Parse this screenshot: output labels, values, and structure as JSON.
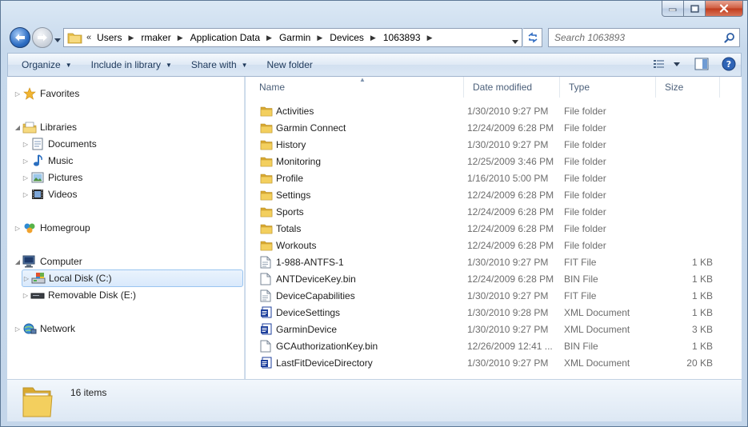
{
  "window": {
    "buttons": {
      "minimize": "minimize",
      "maximize": "maximize",
      "close": "close"
    }
  },
  "address_bar": {
    "overflow_glyph": "«",
    "crumbs": [
      "Users",
      "rmaker",
      "Application Data",
      "Garmin",
      "Devices",
      "1063893"
    ]
  },
  "search": {
    "placeholder": "Search 1063893"
  },
  "command_bar": {
    "organize": "Organize",
    "include_in_library": "Include in library",
    "share_with": "Share with",
    "new_folder": "New folder"
  },
  "nav_pane": {
    "favorites": "Favorites",
    "libraries": "Libraries",
    "documents": "Documents",
    "music": "Music",
    "pictures": "Pictures",
    "videos": "Videos",
    "homegroup": "Homegroup",
    "computer": "Computer",
    "local_disk": "Local Disk (C:)",
    "removable_disk": "Removable Disk (E:)",
    "network": "Network"
  },
  "columns": {
    "name": "Name",
    "date": "Date modified",
    "type": "Type",
    "size": "Size"
  },
  "files": [
    {
      "name": "Activities",
      "date": "1/30/2010 9:27 PM",
      "type": "File folder",
      "size": "",
      "icon": "folder-icon"
    },
    {
      "name": "Garmin Connect",
      "date": "12/24/2009 6:28 PM",
      "type": "File folder",
      "size": "",
      "icon": "folder-icon"
    },
    {
      "name": "History",
      "date": "1/30/2010 9:27 PM",
      "type": "File folder",
      "size": "",
      "icon": "folder-icon"
    },
    {
      "name": "Monitoring",
      "date": "12/25/2009 3:46 PM",
      "type": "File folder",
      "size": "",
      "icon": "folder-icon"
    },
    {
      "name": "Profile",
      "date": "1/16/2010 5:00 PM",
      "type": "File folder",
      "size": "",
      "icon": "folder-icon"
    },
    {
      "name": "Settings",
      "date": "12/24/2009 6:28 PM",
      "type": "File folder",
      "size": "",
      "icon": "folder-icon"
    },
    {
      "name": "Sports",
      "date": "12/24/2009 6:28 PM",
      "type": "File folder",
      "size": "",
      "icon": "folder-icon"
    },
    {
      "name": "Totals",
      "date": "12/24/2009 6:28 PM",
      "type": "File folder",
      "size": "",
      "icon": "folder-icon"
    },
    {
      "name": "Workouts",
      "date": "12/24/2009 6:28 PM",
      "type": "File folder",
      "size": "",
      "icon": "folder-icon"
    },
    {
      "name": "1-988-ANTFS-1",
      "date": "1/30/2010 9:27 PM",
      "type": "FIT File",
      "size": "1 KB",
      "icon": "file-icon"
    },
    {
      "name": "ANTDeviceKey.bin",
      "date": "12/24/2009 6:28 PM",
      "type": "BIN File",
      "size": "1 KB",
      "icon": "blank-file-icon"
    },
    {
      "name": "DeviceCapabilities",
      "date": "1/30/2010 9:27 PM",
      "type": "FIT File",
      "size": "1 KB",
      "icon": "file-icon"
    },
    {
      "name": "DeviceSettings",
      "date": "1/30/2010 9:28 PM",
      "type": "XML Document",
      "size": "1 KB",
      "icon": "xml-file-icon"
    },
    {
      "name": "GarminDevice",
      "date": "1/30/2010 9:27 PM",
      "type": "XML Document",
      "size": "3 KB",
      "icon": "xml-file-icon"
    },
    {
      "name": "GCAuthorizationKey.bin",
      "date": "12/26/2009 12:41 ...",
      "type": "BIN File",
      "size": "1 KB",
      "icon": "blank-file-icon"
    },
    {
      "name": "LastFitDeviceDirectory",
      "date": "1/30/2010 9:27 PM",
      "type": "XML Document",
      "size": "20 KB",
      "icon": "xml-file-icon"
    }
  ],
  "details": {
    "count": "16 items"
  },
  "colors": {
    "accent": "#1e395b",
    "selection_bg": "#d9e9fb",
    "selection_border": "#99c4f0",
    "folder": "#e8c04b",
    "xml_icon": "#1d3f9c"
  }
}
